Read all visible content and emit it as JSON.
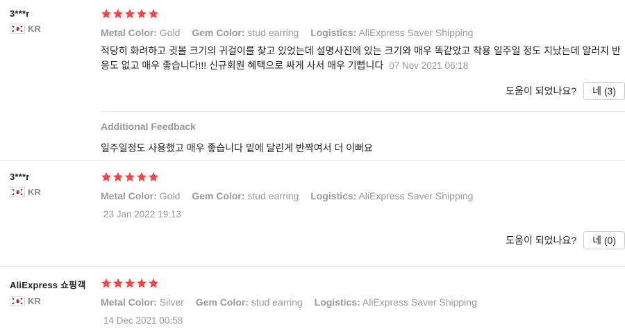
{
  "reviews": [
    {
      "username": "3***r",
      "country": "KR",
      "rating": 5,
      "attributes": [
        {
          "label": "Metal Color:",
          "value": "Gold"
        },
        {
          "label": "Gem Color:",
          "value": "stud earring"
        },
        {
          "label": "Logistics:",
          "value": "AliExpress Saver Shipping"
        }
      ],
      "text": "적당히 화려하고 귓볼 크기의 귀걸이를 찾고 있었는데 설명사진에 있는 크기와 매우 똑같았고 착용 일주일 정도 지났는데 알러지 반응도 없고 매우 좋습니다!!! 신규회원 혜택으로 싸게 사서 매우 기뻡니다",
      "date": "07 Nov 2021 06:18",
      "helpful_question": "도움이 되었나요?",
      "helpful_button": "네 (3)",
      "additional_feedback_title": "Additional Feedback",
      "additional_feedback_text": "일주일정도 사용했고 매우 좋습니다 밑에 달린게 반짝여서 더 이뻐요"
    },
    {
      "username": "3***r",
      "country": "KR",
      "rating": 5,
      "attributes": [
        {
          "label": "Metal Color:",
          "value": "Gold"
        },
        {
          "label": "Gem Color:",
          "value": "stud earring"
        },
        {
          "label": "Logistics:",
          "value": "AliExpress Saver Shipping"
        }
      ],
      "date": "23 Jan 2022 19:13",
      "helpful_question": "도움이 되었나요?",
      "helpful_button": "네 (0)"
    },
    {
      "username": "AliExpress 쇼핑객",
      "country": "KR",
      "rating": 5,
      "attributes": [
        {
          "label": "Metal Color:",
          "value": "Silver"
        },
        {
          "label": "Gem Color:",
          "value": "stud earring"
        },
        {
          "label": "Logistics:",
          "value": "AliExpress Saver Shipping"
        }
      ],
      "date": "14 Dec 2021 00:58"
    }
  ],
  "colors": {
    "star": "#f44444",
    "muted": "#999999",
    "text": "#222222"
  }
}
